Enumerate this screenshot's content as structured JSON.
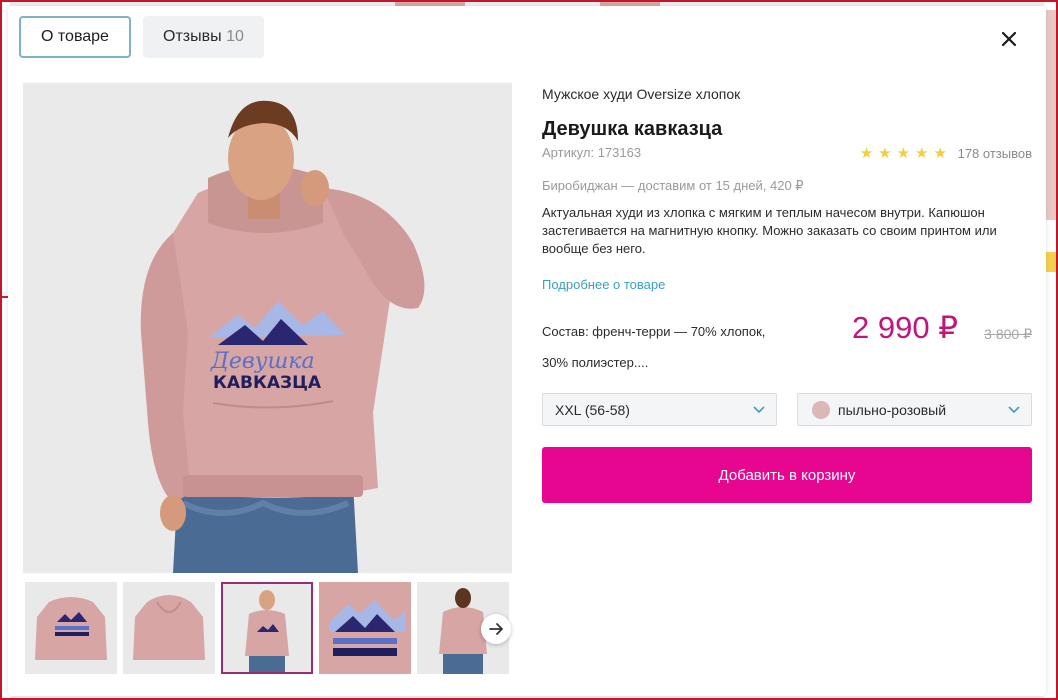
{
  "tabs": [
    {
      "label": "О товаре"
    },
    {
      "label": "Отзывы",
      "count": "10"
    }
  ],
  "product": {
    "category": "Мужское худи Oversize хлопок",
    "title": "Девушка кавказца",
    "article": "Артикул: 173163",
    "rating_stars": 5,
    "reviews": "178 отзывов",
    "delivery": "Биробиджан — доставим от 15 дней, 420 ₽",
    "description": "Актуальная худи из хлопка с мягким и теплым начесом внутри. Капюшон застегивается на магнитную кнопку. Можно заказать со своим принтом или вообще без него.",
    "more_link": "Подробнее о товаре",
    "composition_line1": "Состав: френч-терри — 70% хлопок,",
    "composition_line2": "30% полиэстер....",
    "price": "2 990 ₽",
    "old_price": "3 800 ₽",
    "print_text_line1": "Девушка",
    "print_text_line2": "КАВКАЗЦА"
  },
  "selectors": {
    "size": "XXL (56-58)",
    "color": "пыльно-розовый",
    "color_swatch": "#d9b8b7"
  },
  "actions": {
    "add_to_cart": "Добавить в корзину"
  },
  "thumbnails": [
    {
      "view": "front-flat-print"
    },
    {
      "view": "back-flat"
    },
    {
      "view": "model-front",
      "active": true
    },
    {
      "view": "print-closeup"
    },
    {
      "view": "model-back"
    }
  ],
  "colors": {
    "accent": "#e6068f",
    "price": "#c3147a",
    "link": "#3aa0bd",
    "hoodie": "#d7a5a4",
    "active_thumb_border": "#9b2a7a"
  }
}
